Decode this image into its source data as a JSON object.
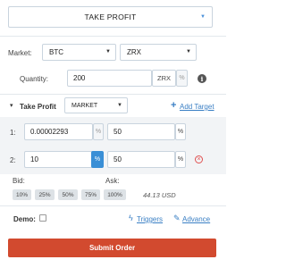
{
  "header": {
    "title": "TAKE PROFIT"
  },
  "market": {
    "label": "Market:",
    "base": "BTC",
    "quote": "ZRX"
  },
  "quantity": {
    "label": "Quantity:",
    "value": "200",
    "unit": "ZRX",
    "percent": "%"
  },
  "take_profit": {
    "label": "Take Profit",
    "type": "MARKET",
    "add_target": "Add Target"
  },
  "targets": [
    {
      "index": "1:",
      "price": "0.00002293",
      "price_unit": "%",
      "percent": "50",
      "percent_unit": "%"
    },
    {
      "index": "2:",
      "price": "10",
      "price_unit": "%",
      "percent": "50",
      "percent_unit": "%"
    }
  ],
  "quotes": {
    "bid_label": "Bid:",
    "ask_label": "Ask:"
  },
  "percent_buttons": [
    "10%",
    "25%",
    "50%",
    "75%",
    "100%"
  ],
  "balance": "44.13 USD",
  "footer": {
    "demo_label": "Demo:",
    "triggers": "Triggers",
    "advance": "Advance"
  },
  "submit": {
    "label": "Submit Order"
  },
  "colors": {
    "accent": "#3a8fd6",
    "submit": "#d24a2f",
    "remove": "#e05050"
  }
}
